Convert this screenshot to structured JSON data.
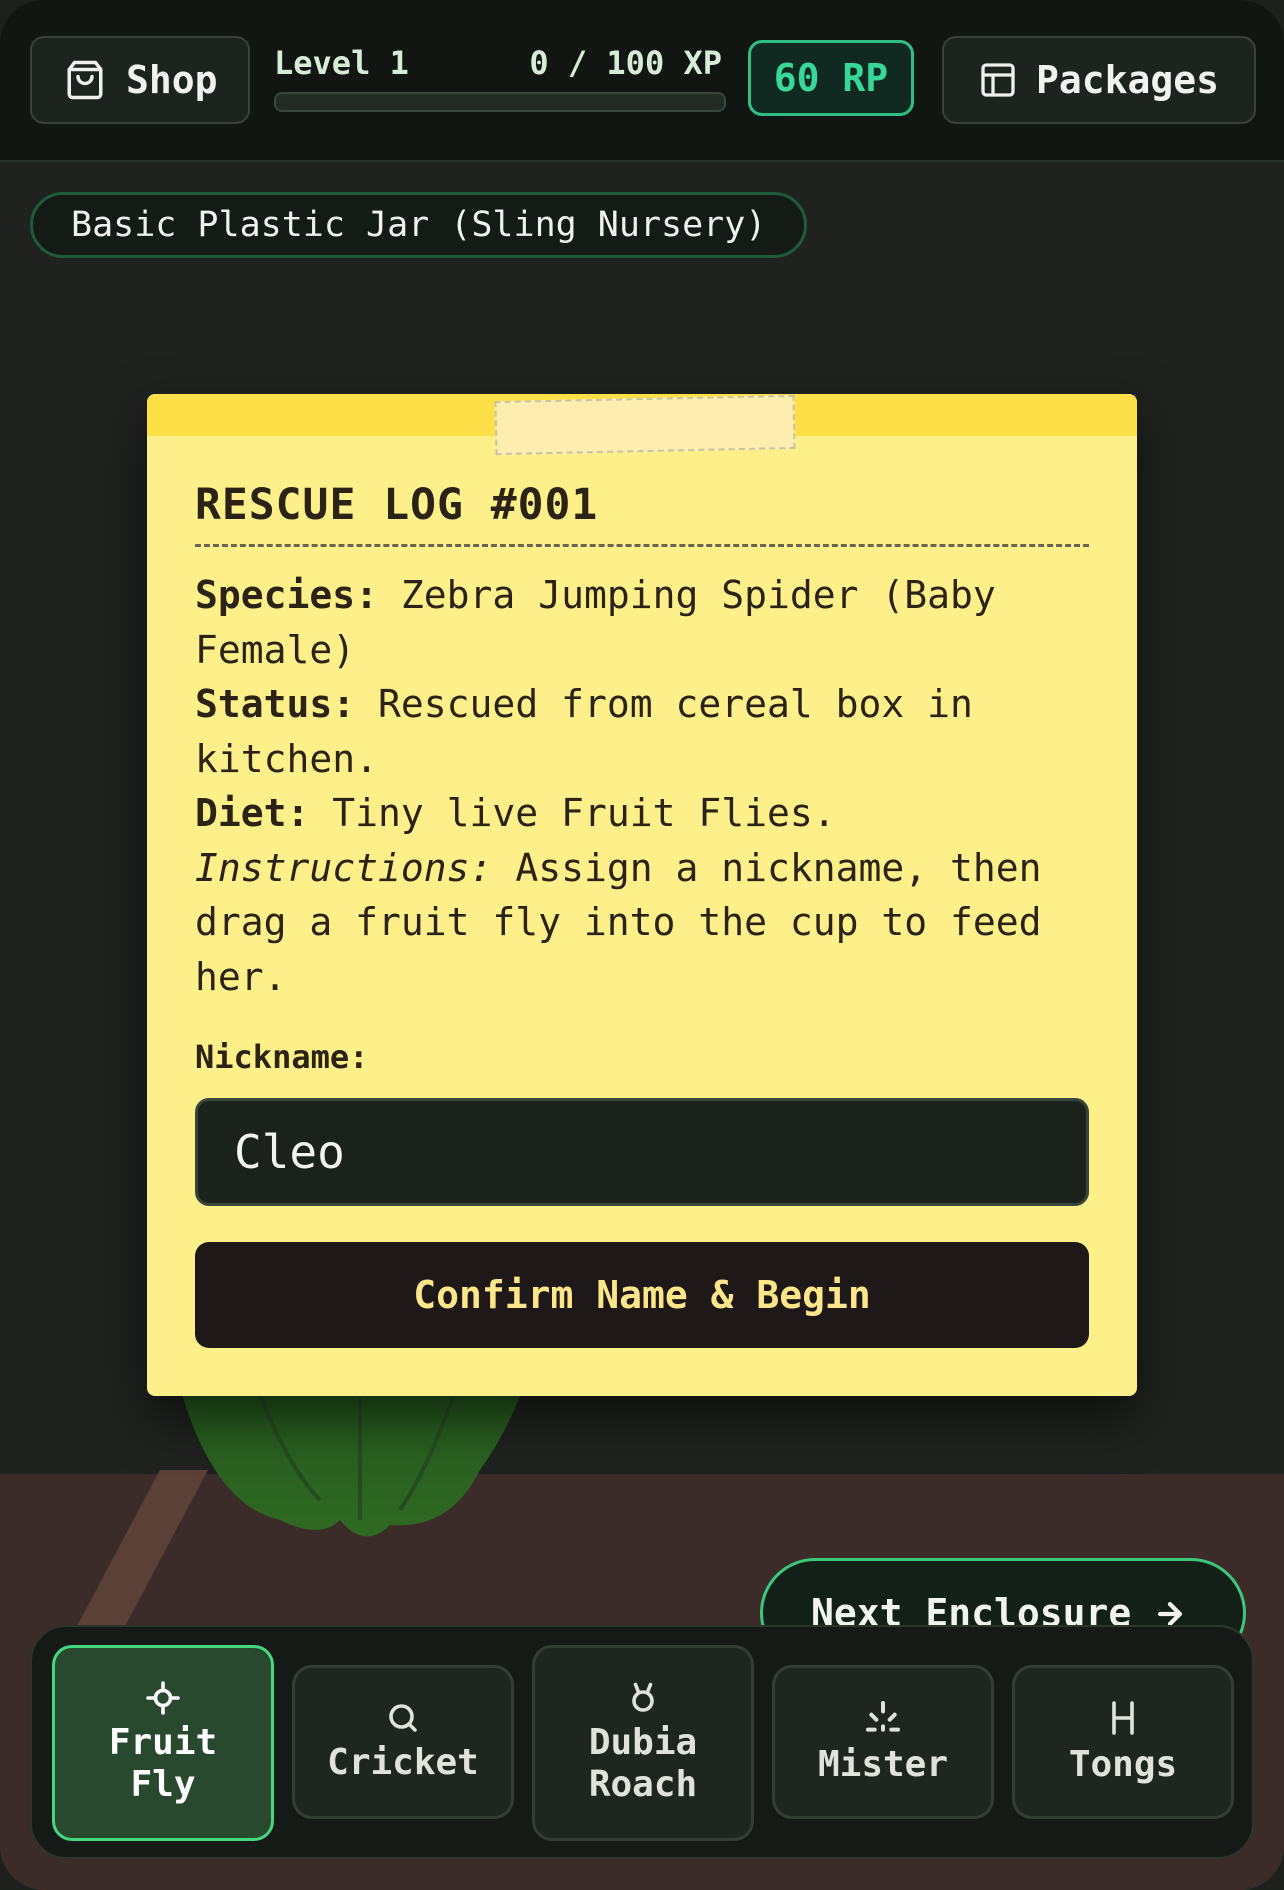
{
  "header": {
    "shop_label": "Shop",
    "level_label": "Level 1",
    "xp_label": "0 / 100 XP",
    "xp_progress": 0,
    "rp_label": "60 RP",
    "packages_label": "Packages"
  },
  "enclosure": {
    "name": "Basic Plastic Jar (Sling Nursery)"
  },
  "rescue_log": {
    "title": "RESCUE LOG #001",
    "species_label": "Species:",
    "species_value": "Zebra Jumping Spider (Baby Female)",
    "status_label": "Status:",
    "status_value": "Rescued from cereal box in kitchen.",
    "diet_label": "Diet:",
    "diet_value": "Tiny live Fruit Flies.",
    "instructions_label": "Instructions:",
    "instructions_value": "Assign a nickname, then drag a fruit fly into the cup to feed her.",
    "nickname_label": "Nickname:",
    "nickname_value": "Cleo",
    "confirm_label": "Confirm Name & Begin"
  },
  "next_enclosure_label": "Next Enclosure",
  "toolbar": {
    "items": [
      {
        "label_line1": "Fruit",
        "label_line2": "Fly",
        "icon": "crosshair-icon",
        "active": true
      },
      {
        "label_line1": "Cricket",
        "icon": "cricket-icon",
        "active": false
      },
      {
        "label_line1": "Dubia",
        "label_line2": "Roach",
        "icon": "roach-icon",
        "active": false
      },
      {
        "label_line1": "Mister",
        "icon": "spray-icon",
        "active": false
      },
      {
        "label_line1": "Tongs",
        "icon": "tongs-icon",
        "active": false
      }
    ]
  },
  "colors": {
    "accent_green": "#46d67f",
    "rp_green": "#38d79a",
    "note_yellow": "#fdef8a"
  }
}
